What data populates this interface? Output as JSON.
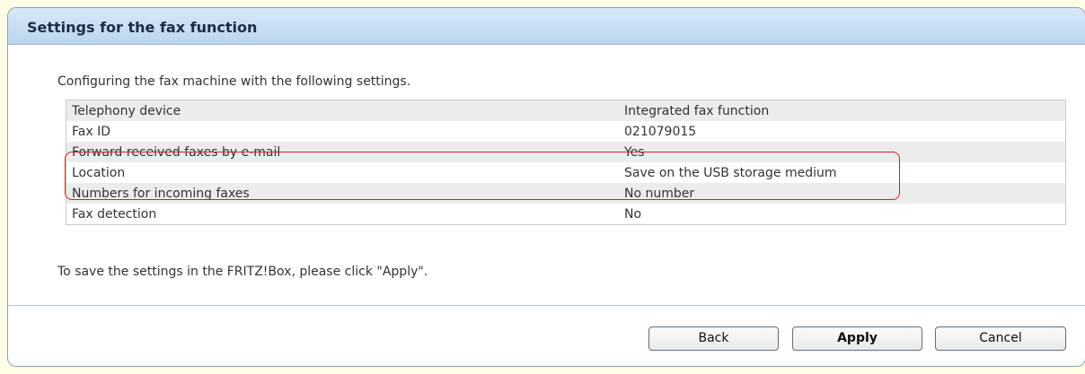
{
  "panel": {
    "title": "Settings for the fax function",
    "intro": "Configuring the fax machine with the following settings.",
    "footer_note": "To save the settings in the FRITZ!Box, please click \"Apply\"."
  },
  "settings": [
    {
      "label": "Telephony device",
      "value": "Integrated fax function"
    },
    {
      "label": "Fax ID",
      "value": "021079015"
    },
    {
      "label": "Forward received faxes by e-mail",
      "value": "Yes"
    },
    {
      "label": "Location",
      "value": "Save on the USB storage medium"
    },
    {
      "label": "Numbers for incoming faxes",
      "value": "No number"
    },
    {
      "label": "Fax detection",
      "value": "No"
    }
  ],
  "highlight_color": "#d42020",
  "buttons": {
    "back": "Back",
    "apply": "Apply",
    "cancel": "Cancel"
  }
}
